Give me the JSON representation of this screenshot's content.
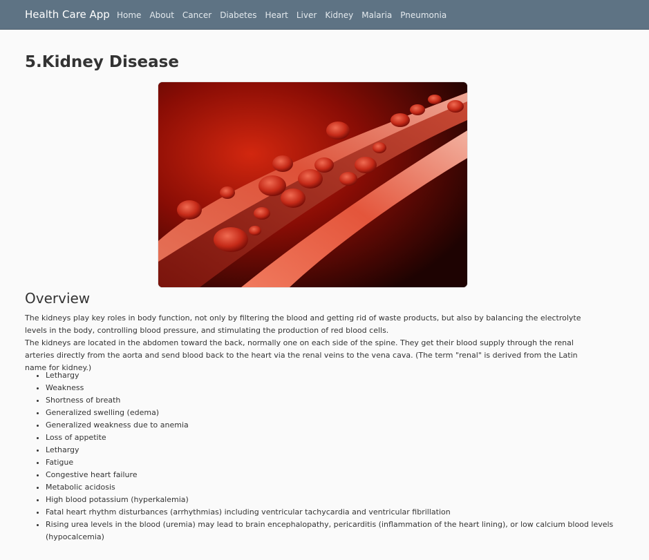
{
  "navbar": {
    "brand": "Health Care App",
    "links": [
      "Home",
      "About",
      "Cancer",
      "Diabetes",
      "Heart",
      "Liver",
      "Kidney",
      "Malaria",
      "Pneumonia"
    ]
  },
  "page": {
    "title": "5.Kidney Disease"
  },
  "overview": {
    "heading": "Overview",
    "paragraph_1": "The kidneys play key roles in body function, not only by filtering the blood and getting rid of waste products, but also by balancing the electrolyte levels in the body, controlling blood pressure, and stimulating the production of red blood cells.",
    "paragraph_2": "The kidneys are located in the abdomen toward the back, normally one on each side of the spine. They get their blood supply through the renal arteries directly from the aorta and send blood back to the heart via the renal veins to the vena cava. (The term \"renal\" is derived from the Latin name for kidney.)"
  },
  "symptoms": [
    "Lethargy",
    "Weakness",
    "Shortness of breath",
    "Generalized swelling (edema)",
    "Generalized weakness due to anemia",
    "Loss of appetite",
    "Lethargy",
    "Fatigue",
    "Congestive heart failure",
    "Metabolic acidosis",
    "High blood potassium (hyperkalemia)",
    "Fatal heart rhythm disturbances (arrhythmias) including ventricular tachycardia and ventricular fibrillation",
    "Rising urea levels in the blood (uremia) may lead to brain encephalopathy, pericarditis (inflammation of the heart lining), or low calcium blood levels (hypocalcemia)"
  ],
  "colors": {
    "navbar_bg": "#5e7384",
    "page_bg": "#fafafa",
    "text": "#333333"
  }
}
